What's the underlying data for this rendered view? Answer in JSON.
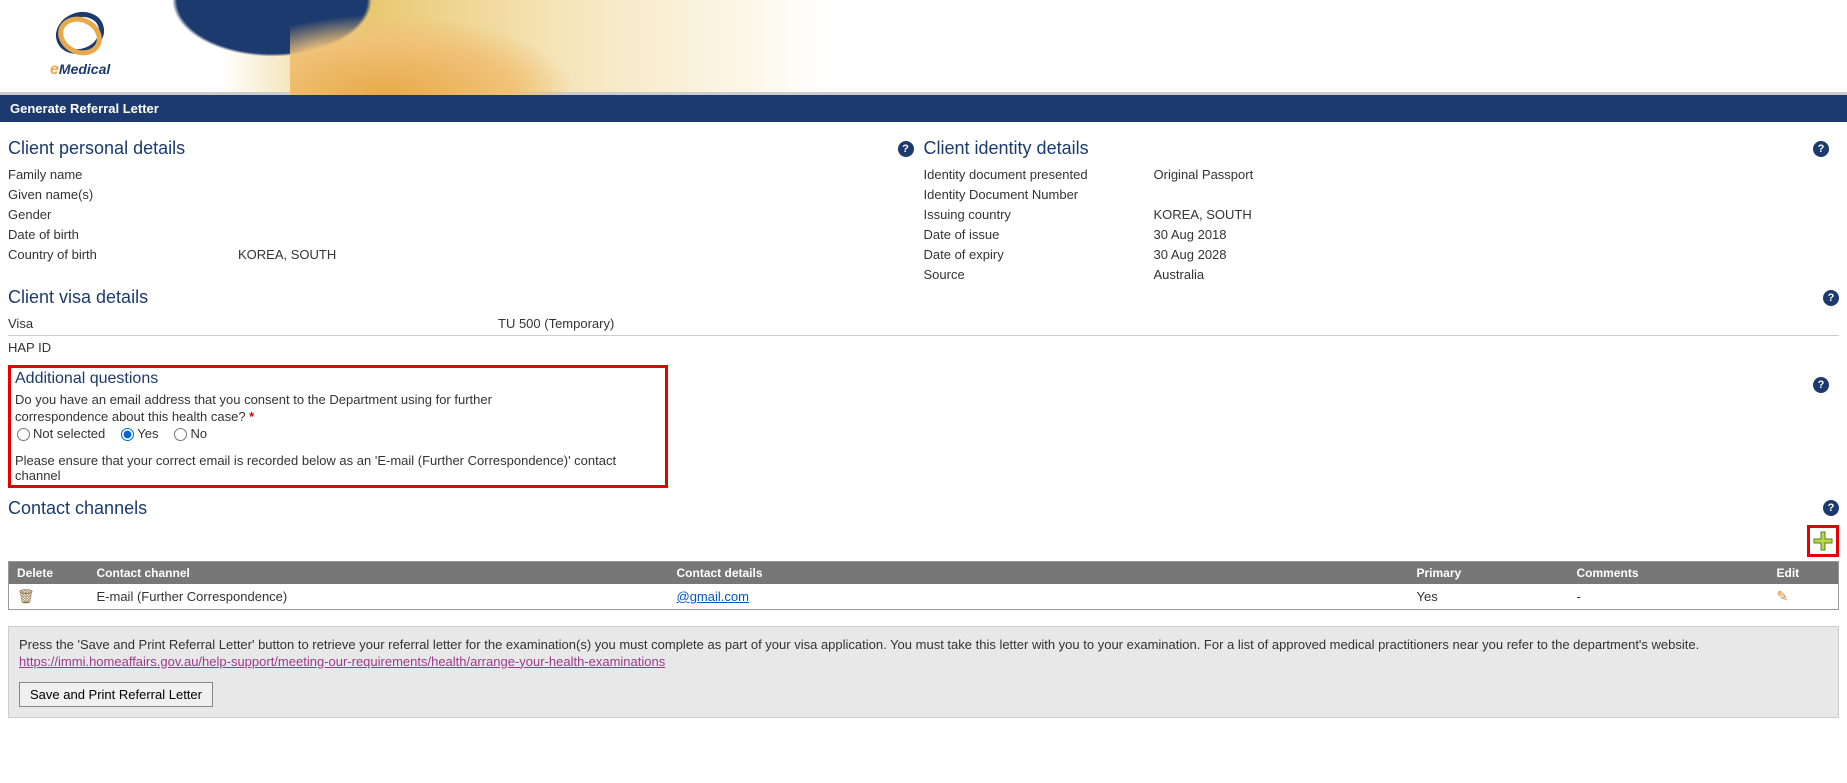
{
  "header": {
    "logo_text_e": "e",
    "logo_text_medical": "Medical"
  },
  "page_title": "Generate Referral Letter",
  "sections": {
    "personal": {
      "title": "Client personal details",
      "fields": {
        "family_name_label": "Family name",
        "family_name_value": "",
        "given_names_label": "Given name(s)",
        "given_names_value": "",
        "gender_label": "Gender",
        "gender_value": "",
        "dob_label": "Date of birth",
        "dob_value": "",
        "country_birth_label": "Country of birth",
        "country_birth_value": "KOREA, SOUTH"
      }
    },
    "identity": {
      "title": "Client identity details",
      "fields": {
        "doc_presented_label": "Identity document presented",
        "doc_presented_value": "Original Passport",
        "doc_number_label": "Identity Document Number",
        "doc_number_value": "",
        "issuing_country_label": "Issuing country",
        "issuing_country_value": "KOREA, SOUTH",
        "date_issue_label": "Date of issue",
        "date_issue_value": "30 Aug 2018",
        "date_expiry_label": "Date of expiry",
        "date_expiry_value": "30 Aug 2028",
        "source_label": "Source",
        "source_value": "Australia"
      }
    },
    "visa": {
      "title": "Client visa details",
      "fields": {
        "visa_label": "Visa",
        "visa_value": "TU 500 (Temporary)",
        "hap_id_label": "HAP ID",
        "hap_id_value": ""
      }
    },
    "additional": {
      "title": "Additional questions",
      "question": "Do you have an email address that you consent to the Department using for further correspondence about this health case?",
      "options": {
        "not_selected": "Not selected",
        "yes": "Yes",
        "no": "No"
      },
      "selected": "yes",
      "instruction": "Please ensure that your correct email is recorded below as an 'E-mail (Further Correspondence)' contact channel"
    },
    "contact": {
      "title": "Contact channels",
      "columns": {
        "delete": "Delete",
        "channel": "Contact channel",
        "details": "Contact details",
        "primary": "Primary",
        "comments": "Comments",
        "edit": "Edit"
      },
      "rows": [
        {
          "channel": "E-mail (Further Correspondence)",
          "details": "@gmail.com",
          "primary": "Yes",
          "comments": "-"
        }
      ]
    }
  },
  "footer": {
    "text_before_link": "Press the 'Save and Print Referral Letter' button to retrieve your referral letter for the examination(s) you must complete as part of your visa application. You must take this letter with you to your examination. For a list of approved medical practitioners near you refer to the department's website. ",
    "link_text": "https://immi.homeaffairs.gov.au/help-support/meeting-our-requirements/health/arrange-your-health-examinations",
    "button_label": "Save and Print Referral Letter"
  },
  "icons": {
    "help": "?",
    "trash": "🗑",
    "pencil": "✎",
    "plus": "+"
  }
}
